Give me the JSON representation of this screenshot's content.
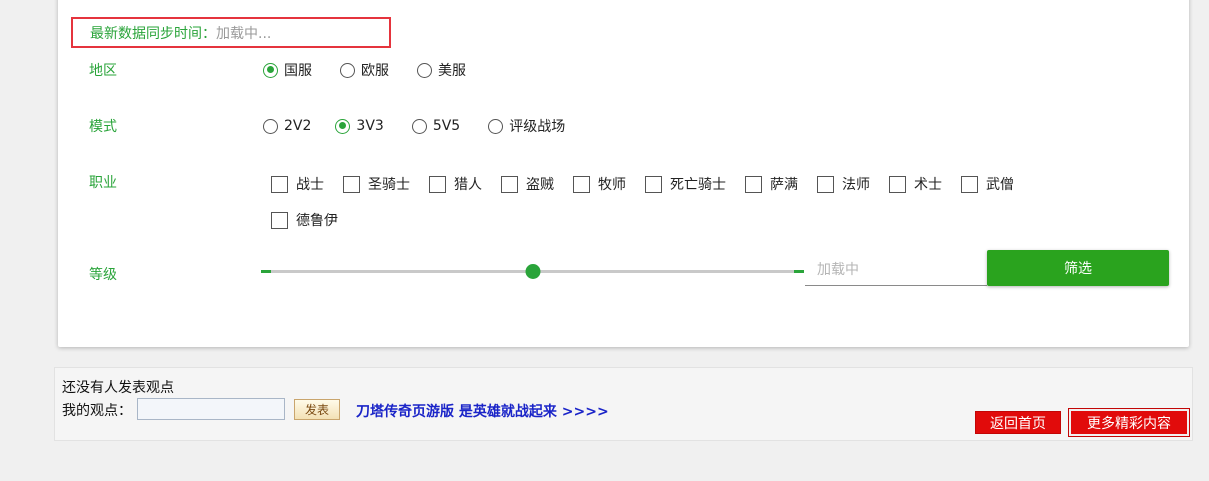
{
  "sync": {
    "label": "最新数据同步时间：",
    "value": "加载中..."
  },
  "region": {
    "label": "地区",
    "options": [
      "国服",
      "欧服",
      "美服"
    ],
    "selected": "国服"
  },
  "mode": {
    "label": "模式",
    "options": [
      "2V2",
      "3V3",
      "5V5",
      "评级战场"
    ],
    "selected": "3V3"
  },
  "classes": {
    "label": "职业",
    "options": [
      "战士",
      "圣骑士",
      "猎人",
      "盗贼",
      "牧师",
      "死亡骑士",
      "萨满",
      "法师",
      "术士",
      "武僧",
      "德鲁伊"
    ]
  },
  "level": {
    "label": "等级",
    "slider_value_fraction": 0.5,
    "input_placeholder": "加载中",
    "filter_button": "筛选"
  },
  "comments": {
    "empty_text": "还没有人发表观点",
    "my_view_label": "我的观点：",
    "post_button": "发表",
    "promo_link": "刀塔传奇页游版 是英雄就战起来 >>>>",
    "home_button": "返回首页",
    "more_button": "更多精彩内容"
  },
  "colors": {
    "accent": "#2aa43a",
    "highlight_border": "#e5343d",
    "red_button": "#e10b0b",
    "link": "#1a24c8"
  }
}
